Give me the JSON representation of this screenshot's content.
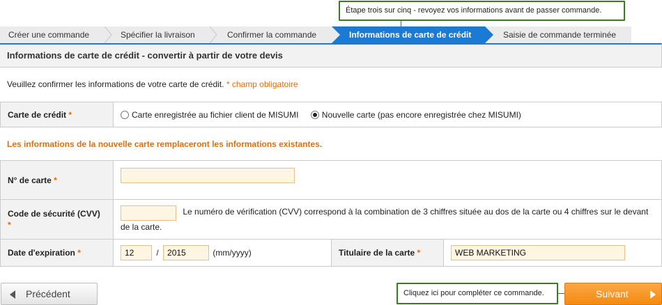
{
  "tooltips": {
    "top": "Étape trois sur cinq - revoyez vos informations avant de passer commande.",
    "bottom": "Cliquez ici pour compléter ce commande."
  },
  "steps": [
    "Créer une commande",
    "Spécifier la livraison",
    "Confirmer la commande",
    "Informations de carte de crédit",
    "Saisie de commande terminée"
  ],
  "active_step": 3,
  "page_title": "Informations de carte de crédit - convertir à partir de votre devis",
  "intro": {
    "text": "Veuillez confirmer les informations de votre carte de crédit.",
    "required_note": "* champ obligatoire"
  },
  "card_choice": {
    "label": "Carte de crédit",
    "required_mark": "*",
    "option_saved": "Carte enregistrée au fichier client de MISUMI",
    "option_new": "Nouvelle carte (pas encore enregistrée chez MISUMI)",
    "selected": "new"
  },
  "warning": "Les informations de la nouvelle carte remplaceront les informations existantes.",
  "form": {
    "card_number": {
      "label": "N° de carte",
      "required_mark": "*",
      "value": ""
    },
    "cvv": {
      "label": "Code de sécurité (CVV)",
      "required_mark": "*",
      "value": "",
      "help": "Le numéro de vérification (CVV) correspond à la combination de 3 chiffres située au dos de la carte ou 4 chiffres sur le devant de la carte."
    },
    "expiration": {
      "label": "Date d'expiration",
      "required_mark": "*",
      "month": "12",
      "separator": "/",
      "year": "2015",
      "format_hint": "(mm/yyyy)"
    },
    "holder": {
      "label": "Titulaire de la carte",
      "required_mark": "*",
      "value": "WEB MARKETING"
    }
  },
  "buttons": {
    "previous": "Précédent",
    "next": "Suivant"
  },
  "colors": {
    "accent_blue": "#1a7ad4",
    "required_orange": "#e36d0a",
    "tooltip_border": "#3a7d1e",
    "next_button": "#f48a0f"
  }
}
